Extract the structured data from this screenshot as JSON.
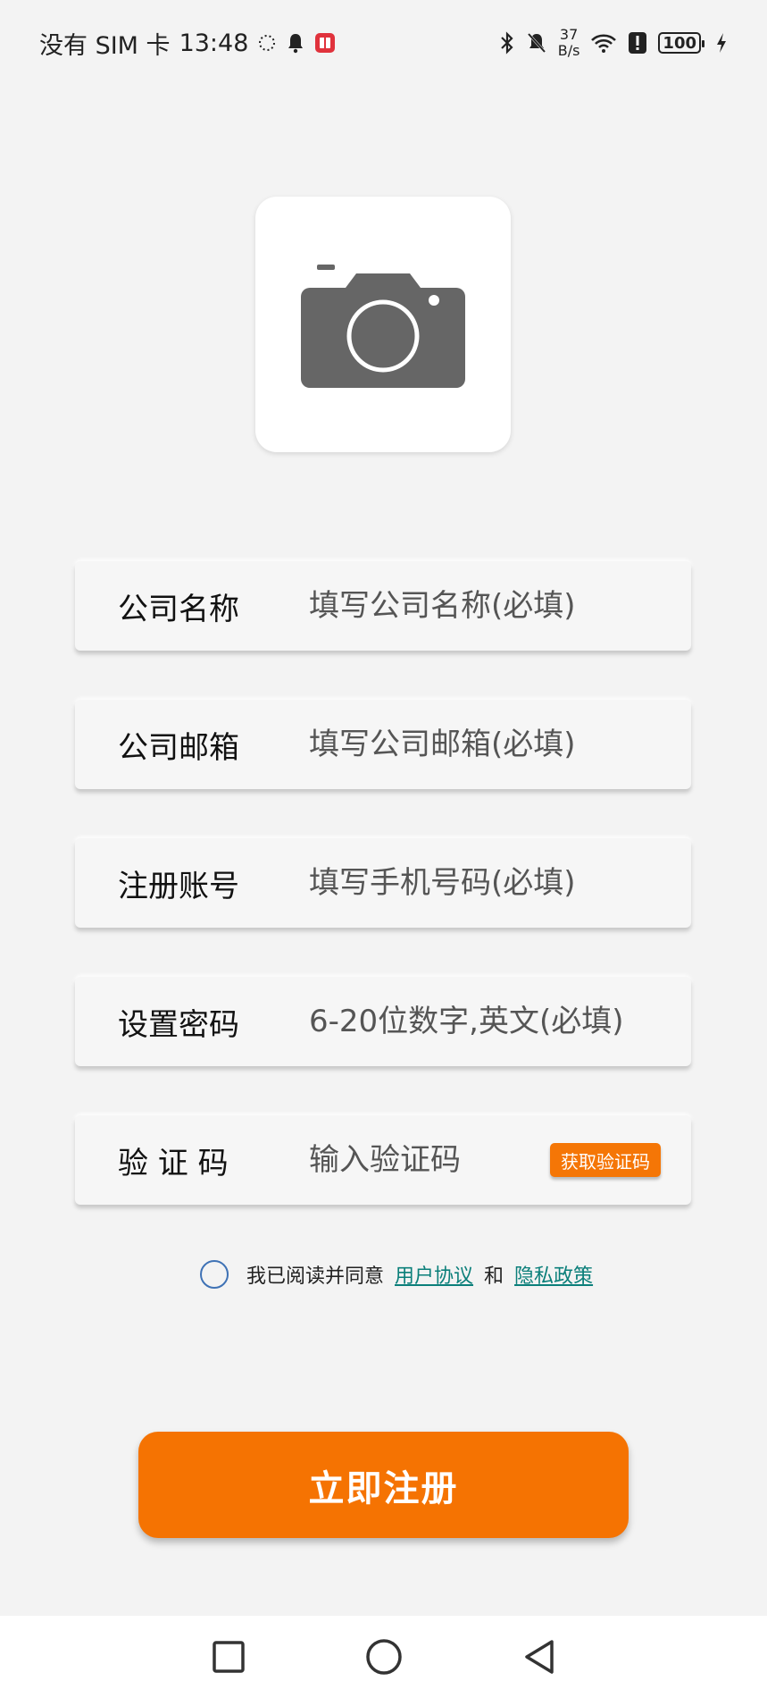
{
  "status_bar": {
    "carrier": "没有 SIM 卡",
    "time": "13:48",
    "net_speed_value": "37",
    "net_speed_unit": "B/s",
    "battery": "100"
  },
  "form": {
    "company_name": {
      "label": "公司名称",
      "placeholder": "填写公司名称(必填)"
    },
    "company_email": {
      "label": "公司邮箱",
      "placeholder": "填写公司邮箱(必填)"
    },
    "account": {
      "label": "注册账号",
      "placeholder": "填写手机号码(必填)"
    },
    "password": {
      "label": "设置密码",
      "placeholder": "6-20位数字,英文(必填)"
    },
    "verify": {
      "label": "验 证 码",
      "placeholder": "输入验证码",
      "get_code_label": "获取验证码"
    }
  },
  "agreement": {
    "prefix": "我已阅读并同意",
    "user_agreement": "用户协议",
    "and": "和",
    "privacy_policy": "隐私政策"
  },
  "register_label": "立即注册",
  "colors": {
    "accent": "#f57302",
    "link": "#0b7f7a",
    "radio": "#3f72b5"
  }
}
